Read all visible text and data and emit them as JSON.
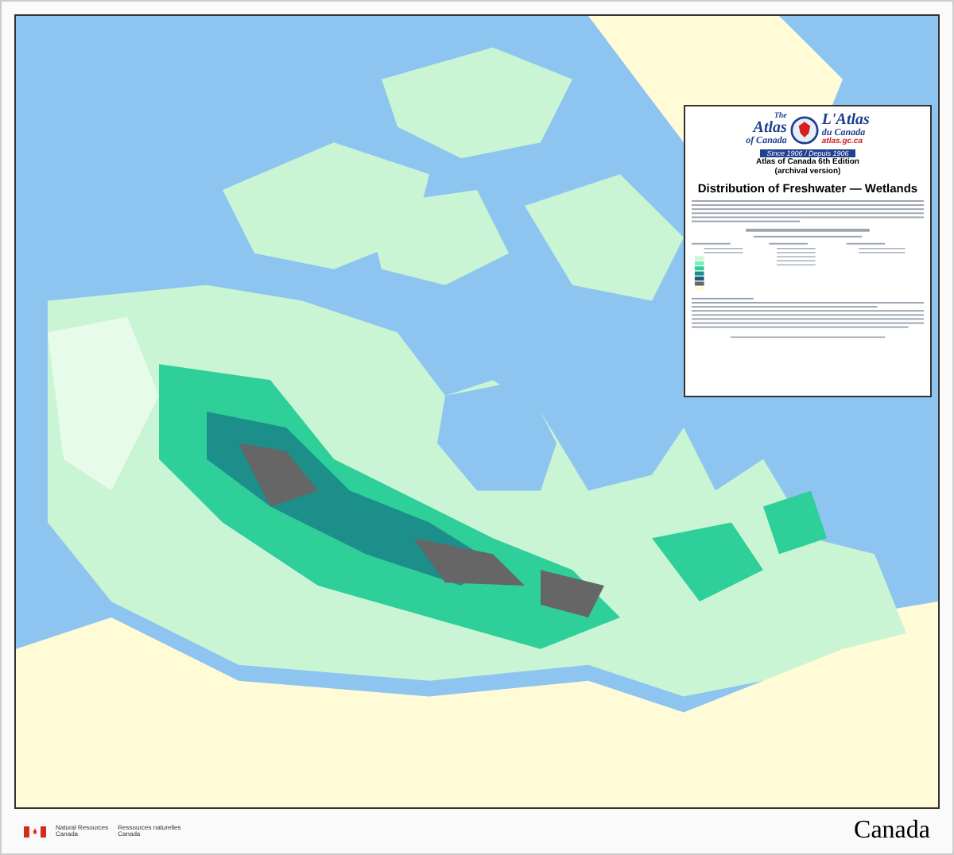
{
  "legend": {
    "logo": {
      "en_small": "The",
      "en_big": "Atlas",
      "en_sub": "of Canada",
      "fr_big": "L'Atlas",
      "fr_sub": "du Canada",
      "url": "atlas.gc.ca",
      "banner": "Since 1906 / Depuis 1906"
    },
    "edition": "Atlas of Canada 6th Edition",
    "edition_note": "(archival version)",
    "title": "Distribution of Freshwater — Wetlands"
  },
  "footer": {
    "department_en": [
      "Natural Resources",
      "Canada"
    ],
    "department_fr": [
      "Ressources naturelles",
      "Canada"
    ],
    "wordmark": "Canada"
  }
}
